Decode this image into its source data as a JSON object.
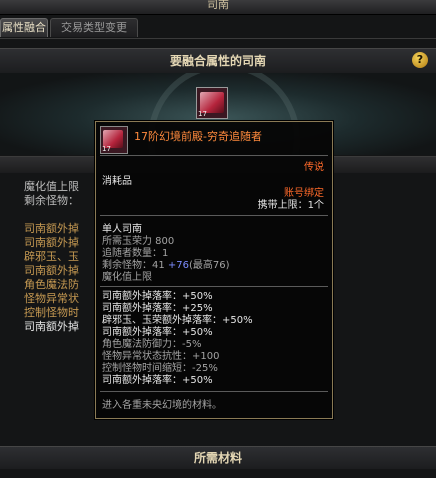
{
  "window": {
    "title": "司南"
  },
  "tabs": [
    {
      "label": "属性融合",
      "active": true
    },
    {
      "label": "交易类型变更",
      "active": false
    }
  ],
  "section_title": "要融合属性的司南",
  "help_label": "?",
  "slot": {
    "level": "17"
  },
  "background_text": {
    "line1": "魔化值上限",
    "line2": "剩余怪物：",
    "list": [
      "司南额外掉",
      "司南额外掉",
      "辟邪玉、玉",
      "司南额外掉",
      "角色魔法防",
      "怪物异常状",
      "控制怪物时",
      "司南额外掉"
    ]
  },
  "bottom_title": "所需材料",
  "tooltip": {
    "item_level": "17",
    "name": "17阶幻境前殿-穷奇追随者",
    "rarity": "传说",
    "category": "消耗品",
    "bind": "账号绑定",
    "carry_limit": "携带上限：1个",
    "block1": [
      "单人司南",
      "所需玉荣力 800",
      "追随者数量：1"
    ],
    "remaining_prefix": "剩余怪物：41",
    "remaining_bonus": "+76",
    "remaining_suffix": "(最高76)",
    "magic_cap": "魔化值上限",
    "stats": [
      "司南额外掉落率：+50%",
      "司南额外掉落率：+25%",
      "辟邪玉、玉荣额外掉落率：+50%",
      "司南额外掉落率：+50%",
      "角色魔法防御力：-5%",
      "怪物异常状态抗性：+100",
      "控制怪物时间缩短：-25%",
      "司南额外掉落率：+50%"
    ],
    "footer": "进入各重未央幻境的材料。"
  }
}
